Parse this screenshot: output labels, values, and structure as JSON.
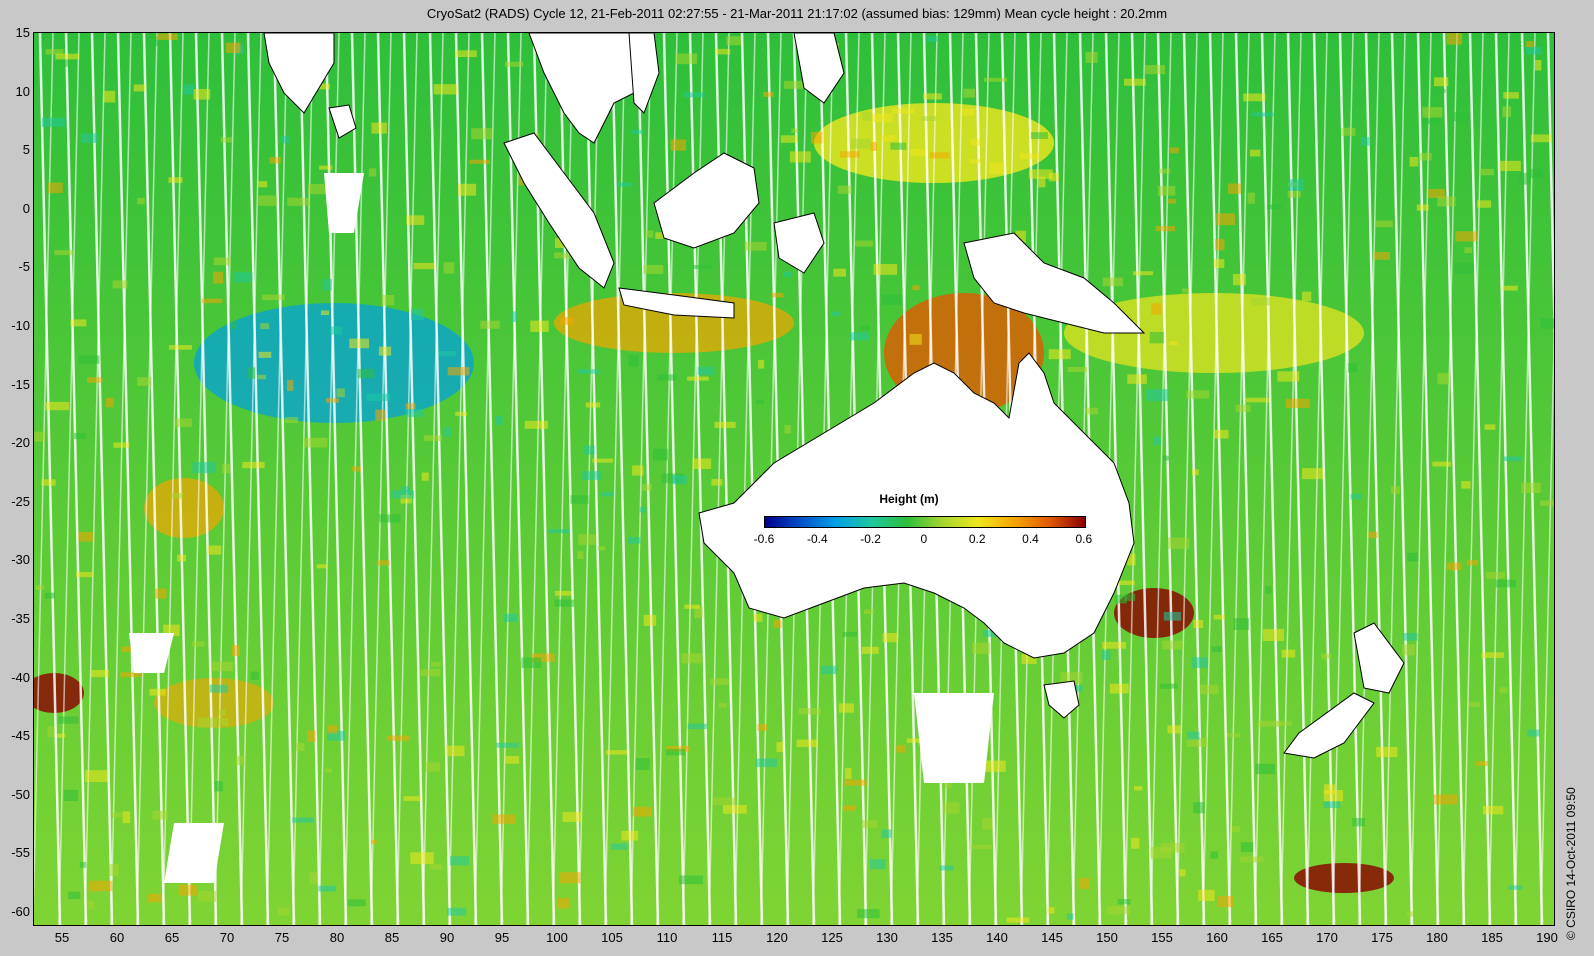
{
  "title": "CryoSat2 (RADS) Cycle 12, 21-Feb-2011 02:27:55 - 21-Mar-2011 21:17:02 (assumed bias: 129mm)  Mean cycle height : 20.2mm",
  "credit": "© CSIRO 14-Oct-2011 09:50",
  "legend": {
    "title": "Height (m)",
    "tick_labels": [
      "-0.6",
      "-0.4",
      "-0.2",
      "0",
      "0.2",
      "0.4",
      "0.6"
    ],
    "colors": [
      "#00008b",
      "#0050c8",
      "#00a0e6",
      "#20c8a0",
      "#2ebf3a",
      "#a6d630",
      "#f0e61e",
      "#f5a500",
      "#e05a00",
      "#8b0000"
    ]
  },
  "axes": {
    "y_tick_labels": [
      "15",
      "10",
      "5",
      "0",
      "-5",
      "-10",
      "-15",
      "-20",
      "-25",
      "-30",
      "-35",
      "-40",
      "-45",
      "-50",
      "-55",
      "-60"
    ],
    "x_tick_labels": [
      "55",
      "60",
      "65",
      "70",
      "75",
      "80",
      "85",
      "90",
      "95",
      "100",
      "105",
      "110",
      "115",
      "120",
      "125",
      "130",
      "135",
      "140",
      "145",
      "150",
      "155",
      "160",
      "165",
      "170",
      "175",
      "180",
      "185",
      "190"
    ],
    "lat_range": [
      -60,
      15
    ],
    "lon_range": [
      52.5,
      190
    ]
  },
  "colors": {
    "ocean_base": "#2ebf3a",
    "land": "#ffffff",
    "coast": "#000000",
    "background": "#c8c8c8"
  }
}
